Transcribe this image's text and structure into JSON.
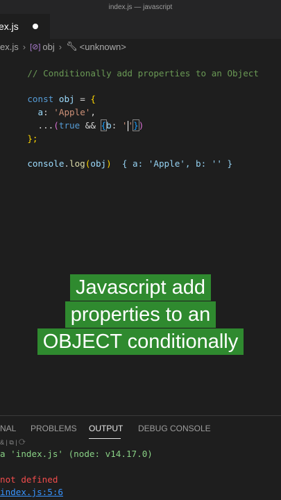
{
  "window": {
    "title": "index.js — javascript"
  },
  "tab": {
    "label": "ex.js"
  },
  "breadcrumb": {
    "file": "ex.js",
    "object": "obj",
    "symbol": "<unknown>"
  },
  "code": {
    "comment": "// Conditionally add properties to an Object",
    "l3_const": "const",
    "l3_name": "obj",
    "l3_eq": " = ",
    "l3_brace": "{",
    "l4_key": "a",
    "l4_colon": ": ",
    "l4_value": "'Apple'",
    "l4_comma": ",",
    "l5_spread": "...",
    "l5_paren_open": "(",
    "l5_true": "true",
    "l5_and": " && ",
    "l5_brace_open": "{",
    "l5_key": "b",
    "l5_colon": ": ",
    "l5_quote1": "'",
    "l5_quote2": "'",
    "l5_brace_close": "}",
    "l5_paren_close": ")",
    "l6_close": "};",
    "l8_console": "console",
    "l8_dot": ".",
    "l8_log": "log",
    "l8_paren_open": "(",
    "l8_arg": "obj",
    "l8_paren_close": ")",
    "l8_result": "{ a: 'Apple', b: '' }"
  },
  "caption": {
    "line1": "Javascript add",
    "line2": "properties to an",
    "line3": "OBJECT conditionally"
  },
  "panel": {
    "tabs": [
      "NAL",
      "PROBLEMS",
      "OUTPUT",
      "DEBUG CONSOLE"
    ],
    "active_tab": "OUTPUT",
    "icons_text": "&  |  ⧉  |  ⟳",
    "output_line1": "a 'index.js' (node: v14.17.0)",
    "output_line2": "not defined",
    "output_line3": "index.js:5:6"
  }
}
